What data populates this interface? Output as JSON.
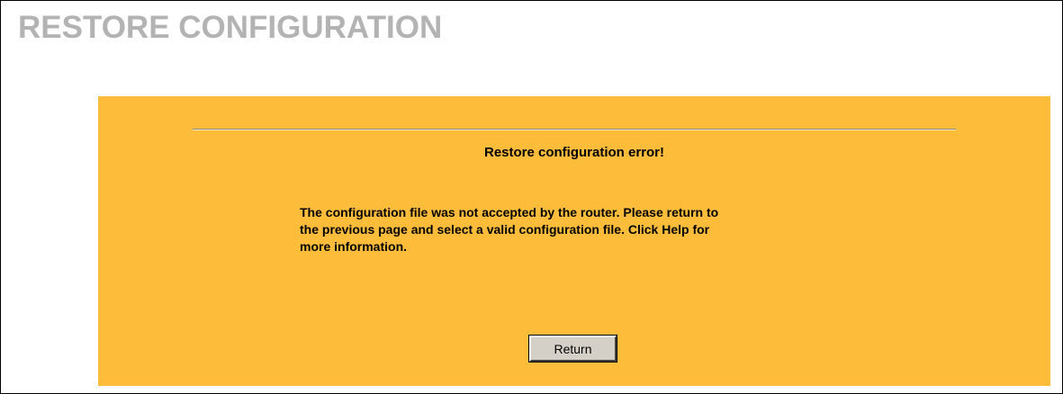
{
  "page": {
    "title": "RESTORE CONFIGURATION"
  },
  "panel": {
    "heading": "Restore configuration error!",
    "message_lines": [
      "The configuration file was not accepted by the router. Please return to",
      "the previous page and select a valid configuration file. Click Help for",
      "more information."
    ],
    "return_label": "Return"
  },
  "colors": {
    "panel_background": "#fdbd3b",
    "title_text": "#b3b3b3",
    "button_face": "#d4d0c8"
  }
}
